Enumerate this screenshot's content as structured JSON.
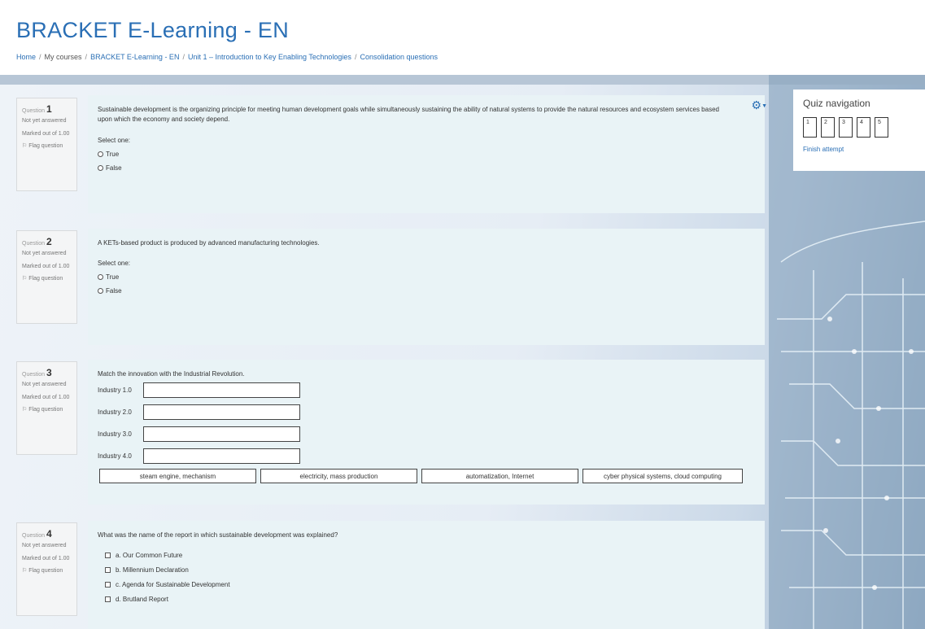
{
  "site": {
    "title": "BRACKET E-Learning - EN"
  },
  "breadcrumb": [
    "Home",
    "My courses",
    "BRACKET E-Learning - EN",
    "Unit 1 – Introduction to Key Enabling Technologies",
    "Consolidation questions"
  ],
  "quiz_nav": {
    "title": "Quiz navigation",
    "buttons": [
      "1",
      "2",
      "3",
      "4",
      "5"
    ],
    "finish_label": "Finish attempt"
  },
  "questions": [
    {
      "prefix": "Question",
      "number": "1",
      "state": "Not yet answered",
      "marked": "Marked out of 1.00",
      "flag": "Flag question",
      "text": "Sustainable development is the organizing principle for meeting human development goals while simultaneously sustaining the ability of natural systems to provide the natural resources and ecosystem services based upon which the economy and society depend.",
      "select_label": "Select one:",
      "options": [
        "True",
        "False"
      ]
    },
    {
      "prefix": "Question",
      "number": "2",
      "state": "Not yet answered",
      "marked": "Marked out of 1.00",
      "flag": "Flag question",
      "text": "A KETs-based product is produced by advanced manufacturing technologies.",
      "select_label": "Select one:",
      "options": [
        "True",
        "False"
      ]
    },
    {
      "prefix": "Question",
      "number": "3",
      "state": "Not yet answered",
      "marked": "Marked out of 1.00",
      "flag": "Flag question",
      "text": "Match the innovation with the Industrial Revolution.",
      "rows": [
        "Industry 1.0",
        "Industry 2.0",
        "Industry 3.0",
        "Industry 4.0"
      ],
      "choices": [
        "steam engine, mechanism",
        "electricity, mass production",
        "automatization, Internet",
        "cyber physical systems, cloud computing"
      ]
    },
    {
      "prefix": "Question",
      "number": "4",
      "state": "Not yet answered",
      "marked": "Marked out of 1.00",
      "flag": "Flag question",
      "text": "What was the name of the report in which sustainable development was explained?",
      "options": [
        "a. Our Common Future",
        "b. Millennium Declaration",
        "c. Agenda for Sustainable Development",
        "d. Brutland Report"
      ]
    }
  ],
  "icons": {
    "gear": "gear-icon",
    "flag": "flag-icon",
    "radio": "radio-icon",
    "checkbox": "checkbox-icon"
  },
  "colors": {
    "link": "#2a6fb5",
    "question_bg": "#e9f3f6",
    "info_bg": "#f4f5f6"
  }
}
